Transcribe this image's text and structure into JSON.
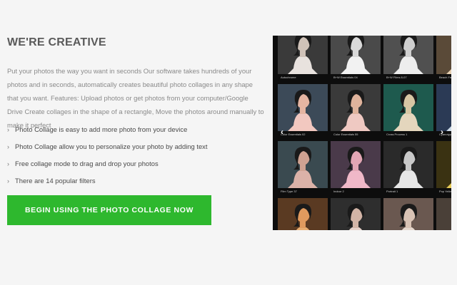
{
  "section": {
    "heading": "WE'RE CREATIVE",
    "description": "Put your photos the way you want in seconds Our software takes hundreds of your photos and in seconds, automatically creates beautiful photo collages in any shape that you want. Features: Upload photos or get photos from your computer/Google Drive Create collages in the shape of a rectangle, Move the photos around manually to make it perfect",
    "features": [
      "Photo Collage is easy to add more photo from your device",
      "Photo Collage allow you to personalize your photo by adding text",
      "Free collage mode to drag and drop your photos",
      "There are 14 popular filters"
    ],
    "cta_label": "BEGIN USING THE PHOTO COLLAGE NOW"
  },
  "gallery": {
    "prev_icon": "chevron-left-icon",
    "next_icon": "chevron-right-icon",
    "rows": [
      [
        {
          "caption": "Autochrome",
          "bg": "#3a3a3a",
          "skin": "#cfc2b8",
          "top": "#e8e2de"
        },
        {
          "caption": "B+W Essentials 04",
          "bg": "#4a4a4a",
          "skin": "#d9d9d9",
          "top": "#f2f2f2"
        },
        {
          "caption": "B+W Films 8-07",
          "bg": "#505050",
          "skin": "#cfcfcf",
          "top": "#ededed"
        },
        {
          "caption": "Beach Faded",
          "bg": "#5a4a38",
          "skin": "#d8b58e",
          "top": "#e6cfb0"
        }
      ],
      [
        {
          "caption": "Color Essentials 02",
          "bg": "#3c4a58",
          "skin": "#e5b5a2",
          "top": "#f2c8c0"
        },
        {
          "caption": "Color Essentials 55",
          "bg": "#3a3a3a",
          "skin": "#dfb39c",
          "top": "#efc9c2"
        },
        {
          "caption": "Cross Process 1",
          "bg": "#1e5a4e",
          "skin": "#d7c6a4",
          "top": "#e4d6bd"
        },
        {
          "caption": "Cyanotype Deep",
          "bg": "#2b3a55",
          "skin": "#b8c8d8",
          "top": "#cddbe8"
        }
      ],
      [
        {
          "caption": "Film Type 37",
          "bg": "#3a4a50",
          "skin": "#cfa292",
          "top": "#dbb2a8"
        },
        {
          "caption": "Indoor 2",
          "bg": "#4a3a4a",
          "skin": "#e2a6b4",
          "top": "#f0b8c8"
        },
        {
          "caption": "Portrait 1",
          "bg": "#2a2a2a",
          "skin": "#c8c8c8",
          "top": "#e6e6e6"
        },
        {
          "caption": "Pop Yellow",
          "bg": "#3a3212",
          "skin": "#d8b838",
          "top": "#e8cc58"
        }
      ],
      [
        {
          "caption": "",
          "bg": "#5a3a22",
          "skin": "#e09a5e",
          "top": "#e8ae72"
        },
        {
          "caption": "",
          "bg": "#2e2e2e",
          "skin": "#d2b4a6",
          "top": "#e6d2ca"
        },
        {
          "caption": "",
          "bg": "#6a5850",
          "skin": "#d8c2b4",
          "top": "#e6d8ce"
        },
        {
          "caption": "",
          "bg": "#4a4038",
          "skin": "#dcc8b8",
          "top": "#ece0d6"
        }
      ]
    ]
  }
}
